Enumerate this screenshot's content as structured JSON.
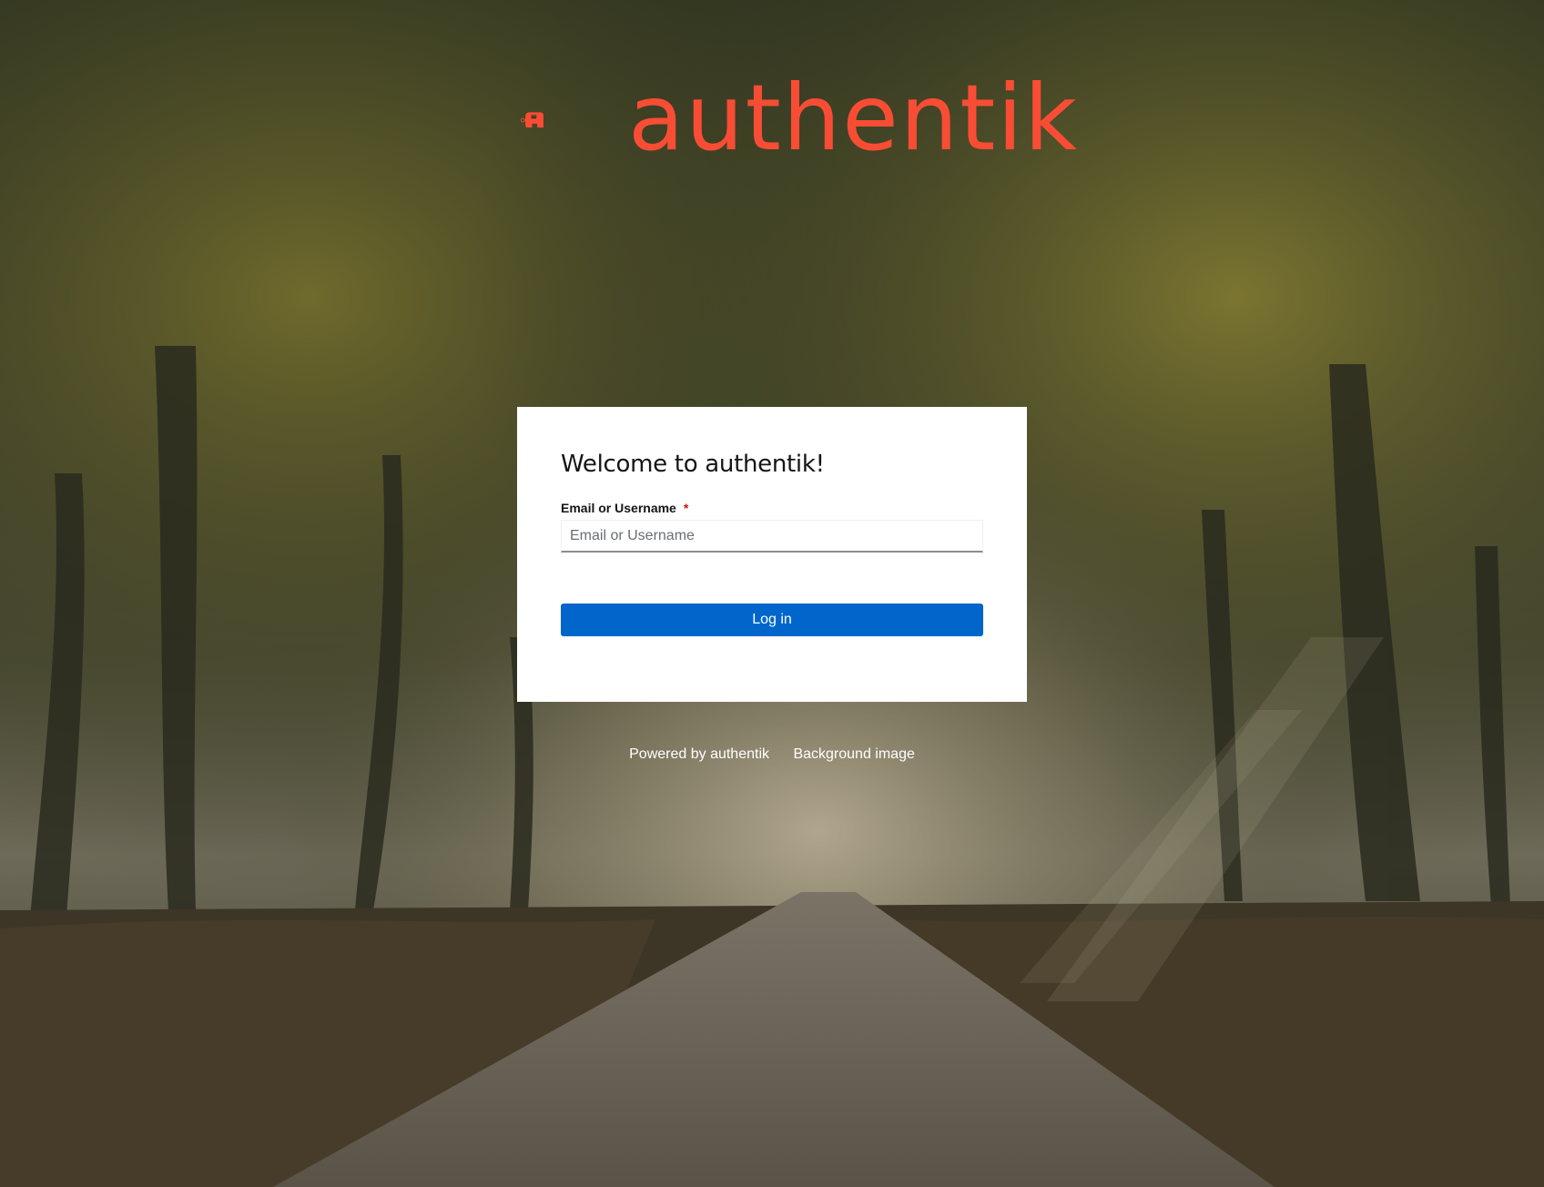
{
  "brand": {
    "name": "authentik",
    "color": "#f84d34"
  },
  "login_card": {
    "title": "Welcome to authentik!",
    "identifier_label": "Email or Username",
    "required_marker": "*",
    "identifier_placeholder": "Email or Username",
    "identifier_value": "",
    "submit_label": "Log in",
    "button_color": "#0066cc"
  },
  "footer": {
    "links": [
      {
        "label": "Powered by authentik"
      },
      {
        "label": "Background image"
      }
    ]
  }
}
